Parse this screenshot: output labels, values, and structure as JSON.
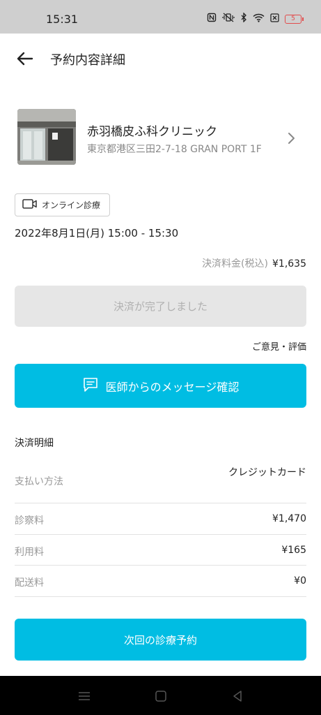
{
  "status_bar": {
    "time": "15:31",
    "battery": "5"
  },
  "header": {
    "title": "予約内容詳細"
  },
  "clinic": {
    "name": "赤羽橋皮ふ科クリニック",
    "address": "東京都港区三田2-7-18 GRAN PORT 1F"
  },
  "appointment": {
    "type_label": "オンライン診療",
    "datetime": "2022年8月1日(月) 15:00 - 15:30"
  },
  "payment": {
    "amount_label": "決済料金(税込)",
    "amount": "¥1,635",
    "done_label": "決済が完了しました"
  },
  "feedback_label": "ご意見・評価",
  "message_button_label": "医師からのメッセージ確認",
  "details": {
    "title": "決済明細",
    "rows": [
      {
        "label": "支払い方法",
        "value": "クレジットカード"
      },
      {
        "label": "診察料",
        "value": "¥1,470"
      },
      {
        "label": "利用料",
        "value": "¥165"
      },
      {
        "label": "配送料",
        "value": "¥0"
      }
    ]
  },
  "next_button_label": "次回の診療予約",
  "colors": {
    "accent": "#00bde3",
    "disabled_bg": "#e6e6e6",
    "status_bar": "#cfcfcf"
  }
}
